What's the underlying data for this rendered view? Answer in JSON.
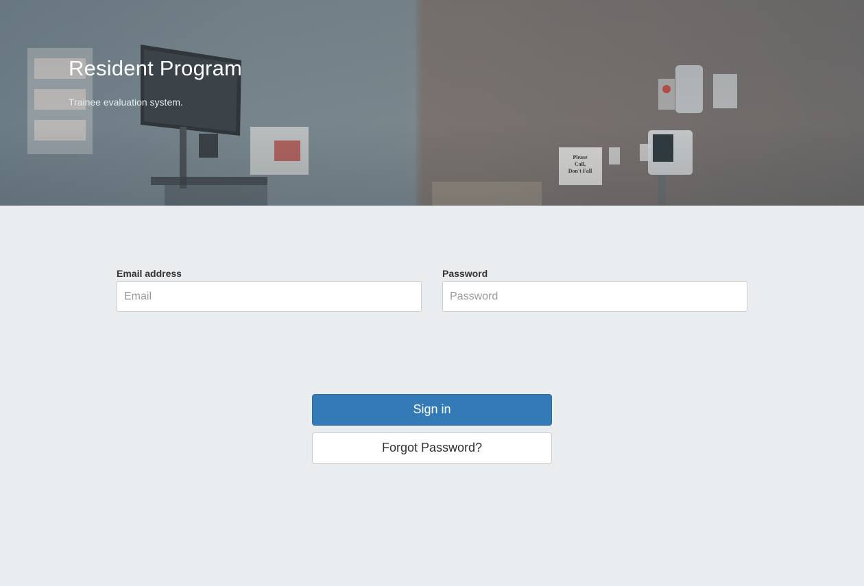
{
  "hero": {
    "title": "Resident Program",
    "subtitle": "Trainee evaluation system.",
    "sign_text": "Please Call, Don't Fall"
  },
  "login_form": {
    "email": {
      "label": "Email address",
      "placeholder": "Email",
      "value": ""
    },
    "password": {
      "label": "Password",
      "placeholder": "Password",
      "value": ""
    },
    "sign_in_label": "Sign in",
    "forgot_password_label": "Forgot Password?"
  },
  "colors": {
    "primary": "#337ab7",
    "page_background": "#eaedf0"
  }
}
